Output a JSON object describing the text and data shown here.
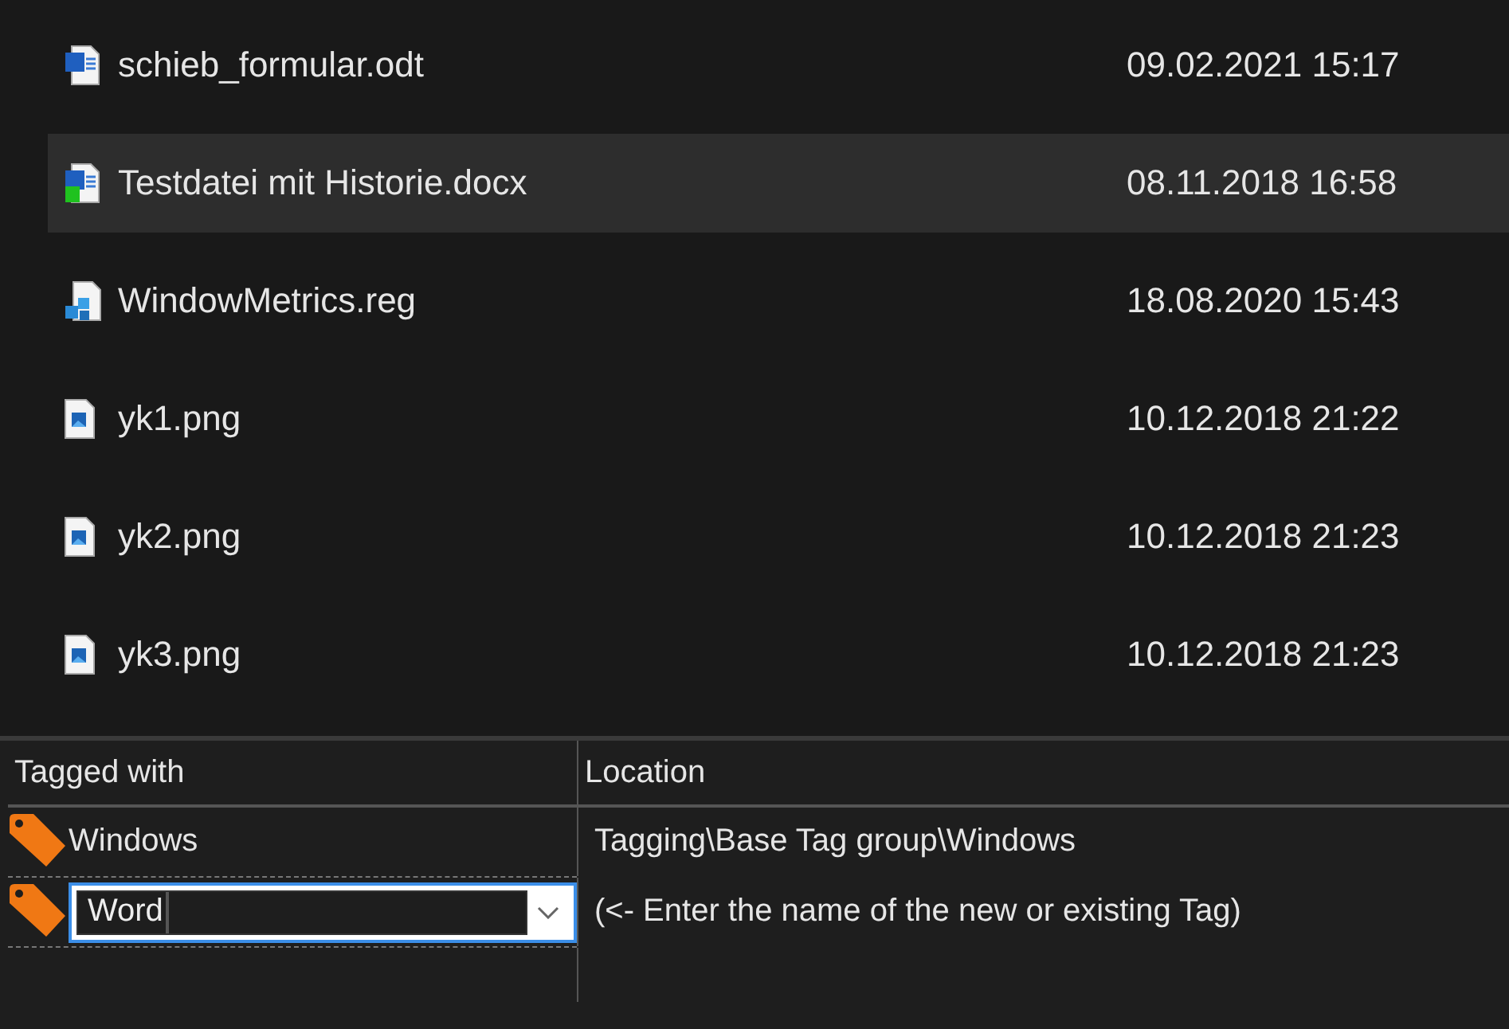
{
  "files": [
    {
      "name": "schieb_formular.odt",
      "modified": "09.02.2021 15:17",
      "kind": "document",
      "selected": false
    },
    {
      "name": "Testdatei mit Historie.docx",
      "modified": "08.11.2018 16:58",
      "kind": "document-badge",
      "selected": true
    },
    {
      "name": "WindowMetrics.reg",
      "modified": "18.08.2020 15:43",
      "kind": "registry",
      "selected": false
    },
    {
      "name": "yk1.png",
      "modified": "10.12.2018 21:22",
      "kind": "image",
      "selected": false
    },
    {
      "name": "yk2.png",
      "modified": "10.12.2018 21:23",
      "kind": "image",
      "selected": false
    },
    {
      "name": "yk3.png",
      "modified": "10.12.2018 21:23",
      "kind": "image",
      "selected": false
    }
  ],
  "tags": {
    "columns": [
      "Tagged with",
      "Location"
    ],
    "rows": [
      {
        "tag": "Windows",
        "location": "Tagging\\Base Tag group\\Windows",
        "editing": false
      },
      {
        "tag": "Word",
        "location": "(<- Enter the name of the new or existing Tag)",
        "editing": true
      }
    ]
  }
}
